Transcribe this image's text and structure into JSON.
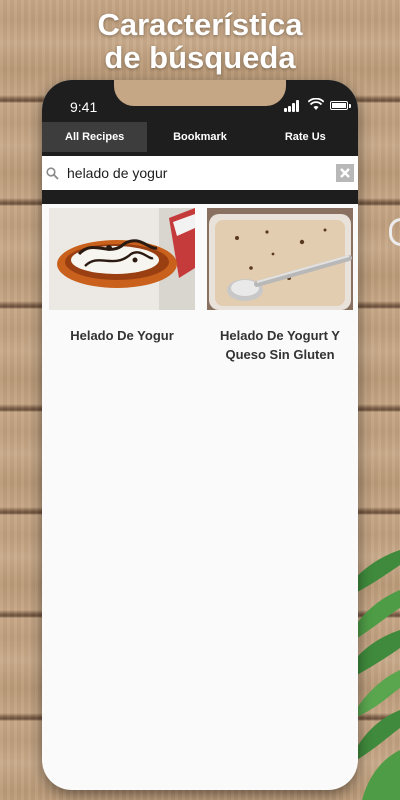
{
  "headline": {
    "line1": "Característica",
    "line2": "de búsqueda"
  },
  "status_bar": {
    "time": "9:41"
  },
  "tabs": [
    {
      "label": "All Recipes",
      "active": true
    },
    {
      "label": "Bookmark",
      "active": false
    },
    {
      "label": "Rate Us",
      "active": false
    }
  ],
  "search": {
    "query": "helado de yogur"
  },
  "results": [
    {
      "title": "Helado De Yogur"
    },
    {
      "title": "Helado De Yogurt Y Queso Sin Gluten"
    }
  ],
  "colors": {
    "bar": "#1e1e1e",
    "active_tab": "#3d3d3d",
    "content_bg": "#fafafa"
  }
}
